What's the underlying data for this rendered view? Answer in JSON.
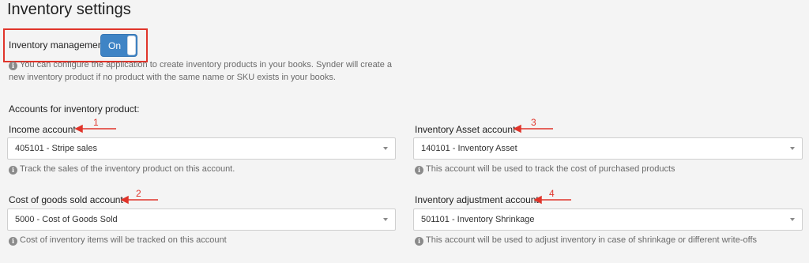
{
  "page": {
    "title": "Inventory settings"
  },
  "inventory_management": {
    "label": "Inventory management",
    "toggle_state": "On",
    "help": "You can configure the application to create inventory products in your books. Synder will create a new inventory product if no product with the same name or SKU exists in your books.",
    "help_icon": "info-icon"
  },
  "accounts": {
    "section_title": "Accounts for inventory product:",
    "income": {
      "label": "Income account",
      "value": "405101 - Stripe sales",
      "help": "Track the sales of the inventory product on this account.",
      "annotation": "1"
    },
    "cogs": {
      "label": "Cost of goods sold account",
      "value": "5000 - Cost of Goods Sold",
      "help": "Cost of inventory items will be tracked on this account",
      "annotation": "2"
    },
    "asset": {
      "label": "Inventory Asset account",
      "value": "140101 - Inventory Asset",
      "help": "This account will be used to track the cost of purchased products",
      "annotation": "3"
    },
    "adjustment": {
      "label": "Inventory adjustment account",
      "value": "501101 - Inventory Shrinkage",
      "help": "This account will be used to adjust inventory in case of shrinkage or different write-offs",
      "annotation": "4"
    }
  },
  "colors": {
    "annotation": "#e0352b",
    "toggle": "#3f84c5",
    "background": "#f4f4f4"
  }
}
